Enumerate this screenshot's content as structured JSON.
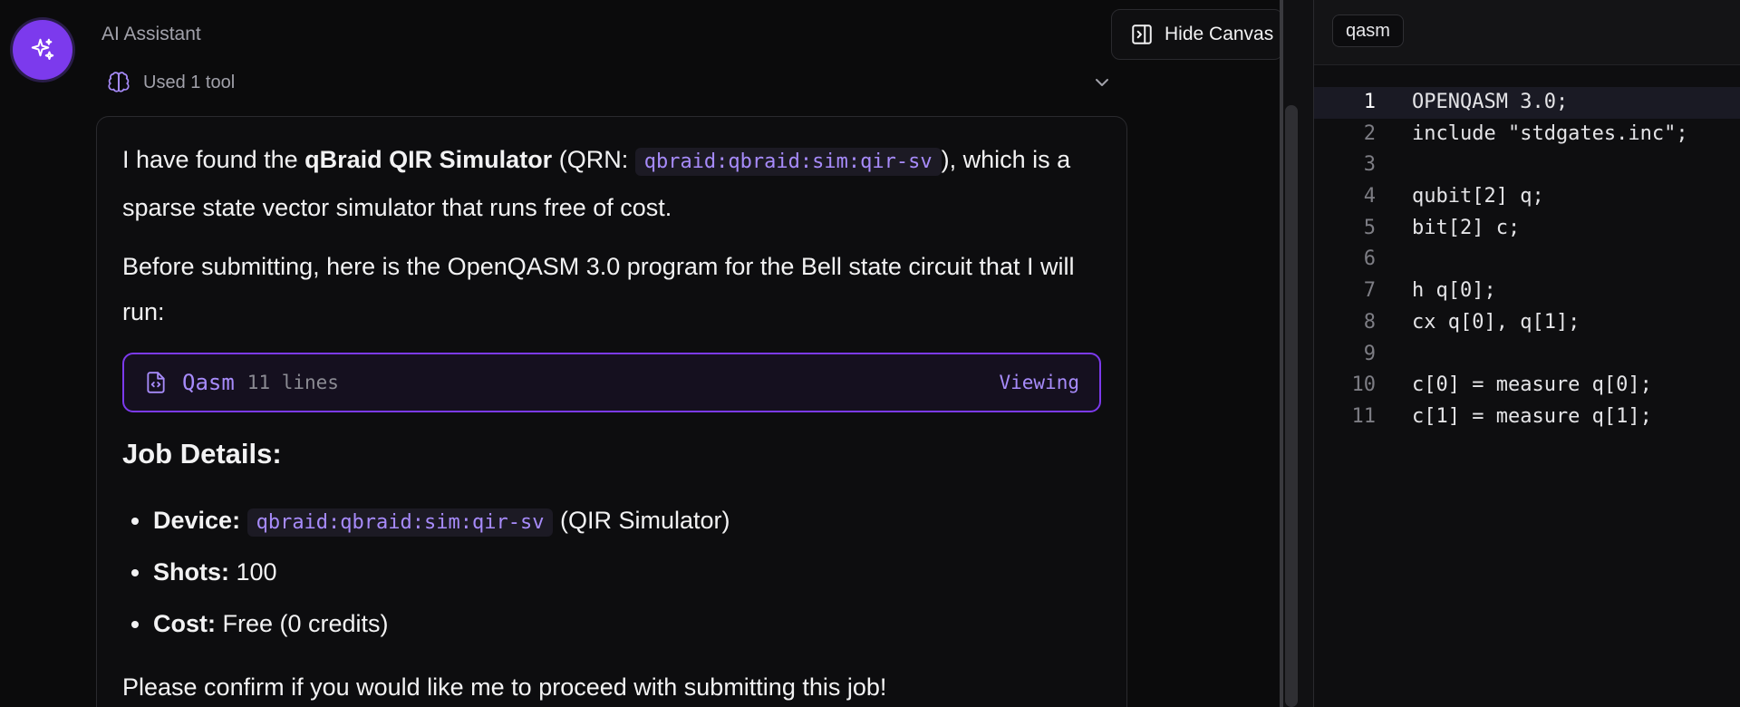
{
  "assistant": {
    "name": "AI Assistant",
    "tool_usage": "Used 1 tool"
  },
  "toolbar": {
    "hide_canvas_label": "Hide Canvas"
  },
  "message": {
    "p1_pre": "I have found the ",
    "p1_bold": "qBraid QIR Simulator",
    "p1_mid": " (QRN: ",
    "p1_code": "qbraid:qbraid:sim:qir-sv",
    "p1_post": "), which is a sparse state vector simulator that runs free of cost.",
    "p2": "Before submitting, here is the OpenQASM 3.0 program for the Bell state circuit that I will run:",
    "attachment": {
      "language": "Qasm",
      "lines": "11 lines",
      "status": "Viewing"
    },
    "job_heading": "Job Details:",
    "job": {
      "device_label": "Device:",
      "device_value": "qbraid:qbraid:sim:qir-sv",
      "device_suffix": " (QIR Simulator)",
      "shots_label": "Shots:",
      "shots_value": " 100",
      "cost_label": "Cost:",
      "cost_value": " Free (0 credits)"
    },
    "p3": "Please confirm if you would like me to proceed with submitting this job!"
  },
  "canvas": {
    "tab_label": "qasm",
    "lines": [
      {
        "n": "1",
        "code": "OPENQASM 3.0;"
      },
      {
        "n": "2",
        "code": "include \"stdgates.inc\";"
      },
      {
        "n": "3",
        "code": ""
      },
      {
        "n": "4",
        "code": "qubit[2] q;"
      },
      {
        "n": "5",
        "code": "bit[2] c;"
      },
      {
        "n": "6",
        "code": ""
      },
      {
        "n": "7",
        "code": "h q[0];"
      },
      {
        "n": "8",
        "code": "cx q[0], q[1];"
      },
      {
        "n": "9",
        "code": ""
      },
      {
        "n": "10",
        "code": "c[0] = measure q[0];"
      },
      {
        "n": "11",
        "code": "c[1] = measure q[1];"
      }
    ]
  },
  "colors": {
    "accent": "#7c3aed",
    "accent_text": "#a78bfa",
    "background": "#0b0b0c"
  }
}
